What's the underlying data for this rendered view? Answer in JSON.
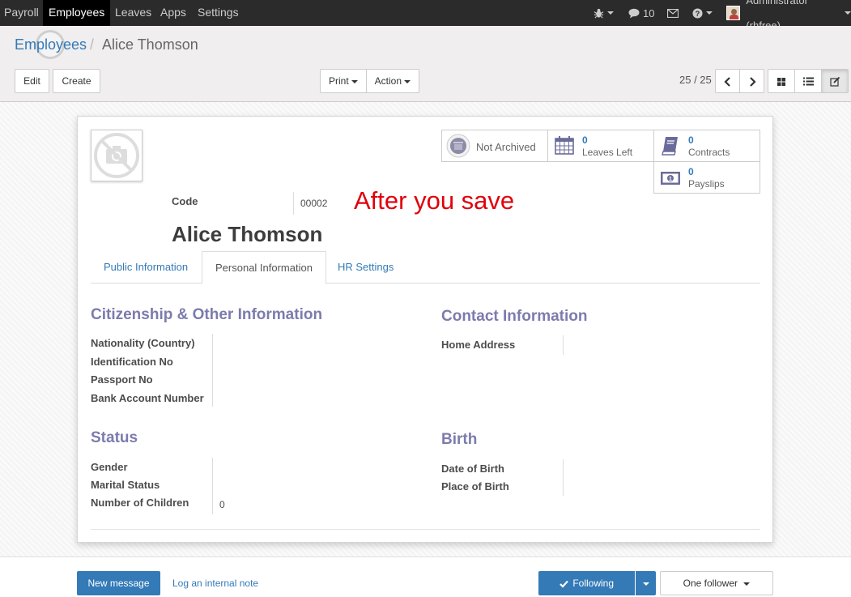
{
  "top_menu": {
    "items": [
      "Payroll",
      "Employees",
      "Leaves",
      "Apps",
      "Settings"
    ],
    "active": "Employees",
    "messages_count": "10",
    "user": "Administrator (rhfree)"
  },
  "breadcrumb": {
    "parent": "Employees",
    "separator": "/",
    "current": "Alice Thomson"
  },
  "buttons": {
    "edit": "Edit",
    "create": "Create",
    "print": "Print",
    "action": "Action"
  },
  "pager": {
    "text": "25 / 25"
  },
  "smart_buttons": {
    "archive": {
      "label": "Not Archived"
    },
    "leaves": {
      "value": "0",
      "label": "Leaves Left"
    },
    "contracts": {
      "value": "0",
      "label": "Contracts"
    },
    "payslips": {
      "value": "0",
      "label": "Payslips"
    }
  },
  "employee": {
    "code_label": "Code",
    "code_value": "00002",
    "name": "Alice Thomson"
  },
  "annotation": "After you save",
  "tabs": [
    "Public Information",
    "Personal Information",
    "HR Settings"
  ],
  "active_tab": "Personal Information",
  "sections": {
    "citizenship": {
      "title": "Citizenship & Other Information",
      "fields": [
        "Nationality (Country)",
        "Identification No",
        "Passport No",
        "Bank Account Number"
      ]
    },
    "contact": {
      "title": "Contact Information",
      "fields": [
        "Home Address"
      ]
    },
    "status": {
      "title": "Status",
      "fields": [
        "Gender",
        "Marital Status",
        "Number of Children"
      ],
      "children_value": "0"
    },
    "birth": {
      "title": "Birth",
      "fields": [
        "Date of Birth",
        "Place of Birth"
      ]
    }
  },
  "chatter": {
    "new_message": "New message",
    "log_note": "Log an internal note",
    "following": "Following",
    "followers": "One follower"
  },
  "colors": {
    "accent": "#337ab7",
    "section": "#7c7bad",
    "annotation": "#e0000b",
    "navbar": "#2b2b2b"
  }
}
